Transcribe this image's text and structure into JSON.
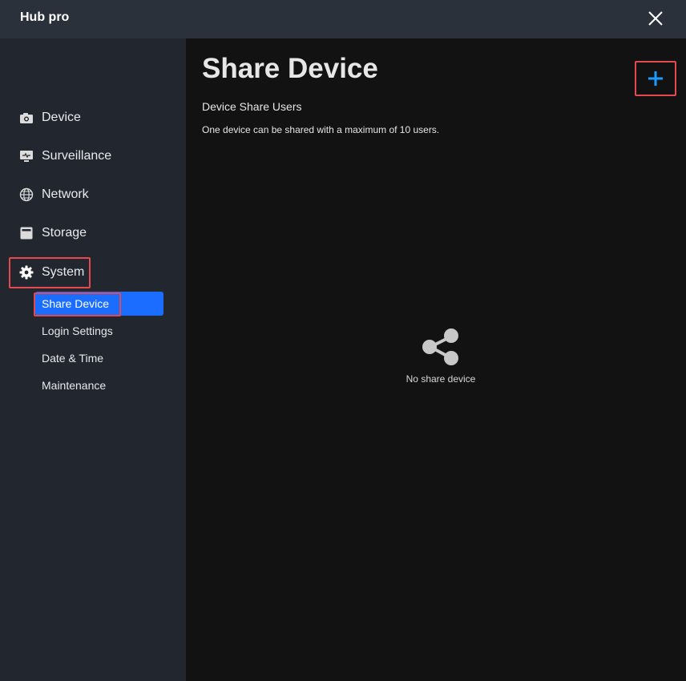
{
  "app": {
    "title": "Hub pro",
    "accent_color": "#1a6dff",
    "highlight_color": "#e5484d",
    "close_icon": "close-icon"
  },
  "sidebar": {
    "items": [
      {
        "label": "Device",
        "icon": "camera-icon"
      },
      {
        "label": "Surveillance",
        "icon": "monitor-icon"
      },
      {
        "label": "Network",
        "icon": "globe-icon"
      },
      {
        "label": "Storage",
        "icon": "storage-icon"
      },
      {
        "label": "System",
        "icon": "gear-icon",
        "expanded": true
      }
    ],
    "system_submenu": [
      {
        "label": "Share Device",
        "active": true
      },
      {
        "label": "Login Settings"
      },
      {
        "label": "Date & Time"
      },
      {
        "label": "Maintenance"
      }
    ]
  },
  "main": {
    "title": "Share Device",
    "section_title": "Device Share Users",
    "description": "One device can be shared with a maximum of 10 users.",
    "add_icon": "plus-icon",
    "empty_state": {
      "icon": "share-icon",
      "text": "No share device"
    }
  }
}
